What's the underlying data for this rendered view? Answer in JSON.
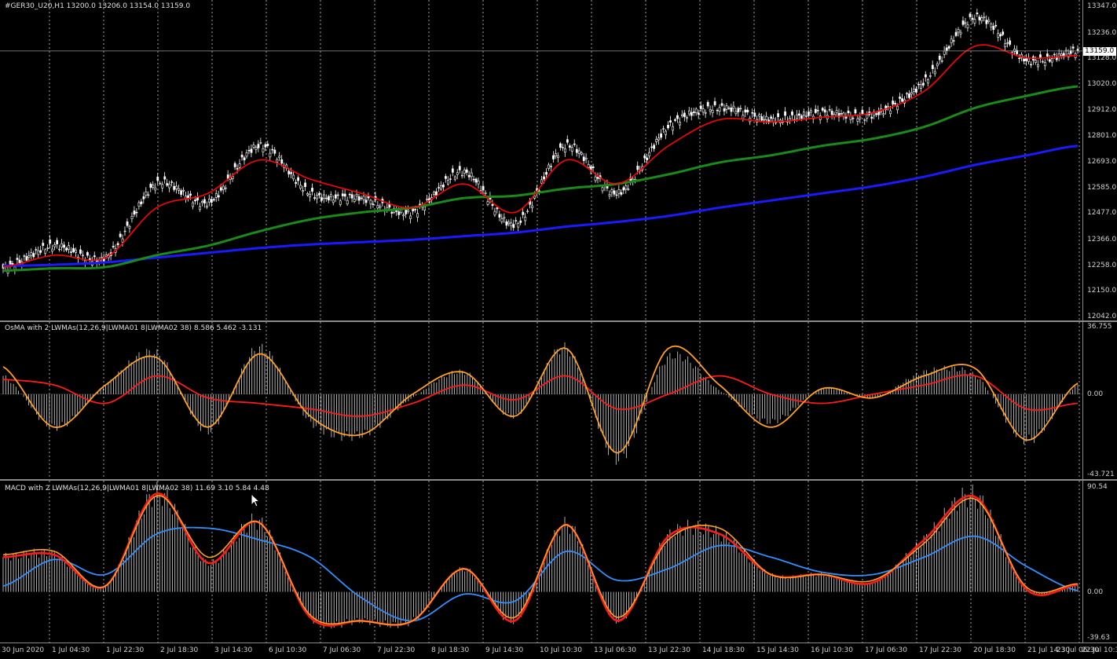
{
  "colors": {
    "background": "#000000",
    "grid": "#c0c0c0",
    "candles": "#ffffff",
    "ma_fast": "#ff0000",
    "ma_mid": "#1a8a1a",
    "ma_slow": "#1a1aff",
    "osma_line": "#ffa020",
    "osma_signal": "#ff1a1a",
    "macd_line": "#ff1a1a",
    "macd_signal_fast": "#ffa020",
    "macd_signal_slow": "#3090ff"
  },
  "main": {
    "caption": "#GER30_U20,H1  13200.0 13206.0 13154.0 13159.0",
    "current_price": "13159.0",
    "price_ticks": [
      "13347.0",
      "13236.0",
      "13128.0",
      "13020.0",
      "12912.0",
      "12801.0",
      "12693.0",
      "12585.0",
      "12477.0",
      "12366.0",
      "12258.0",
      "12150.0",
      "12042.0"
    ]
  },
  "osma": {
    "caption": "OsMA with 2 LWMAs(12,26,9|LWMA01 8|LWMA02 38) 8.586 5.462 -3.131",
    "ticks": [
      "36.755",
      "0.00",
      "-43.721"
    ]
  },
  "macd": {
    "caption": "MACD with 2 LWMAs(12,26,9|LWMA01 8|LWMA02 38) 11.69 3.10 5.84 4.48",
    "ticks": [
      "90.54",
      "0.00",
      "-39.63"
    ]
  },
  "time_axis": [
    "30 Jun 2020",
    "1 Jul 04:30",
    "1 Jul 22:30",
    "2 Jul 18:30",
    "3 Jul 14:30",
    "6 Jul 10:30",
    "7 Jul 06:30",
    "7 Jul 22:30",
    "8 Jul 18:30",
    "9 Jul 14:30",
    "10 Jul 10:30",
    "13 Jul 06:30",
    "13 Jul 22:30",
    "14 Jul 18:30",
    "15 Jul 14:30",
    "16 Jul 10:30",
    "17 Jul 06:30",
    "17 Jul 22:30",
    "20 Jul 18:30",
    "21 Jul 14:30",
    "22 Jul 10:30",
    "23 Jul 06:30"
  ],
  "chart_data": [
    {
      "type": "line",
      "title": "#GER30_U20,H1",
      "ohlc_last": {
        "open": 13200.0,
        "high": 13206.0,
        "low": 13154.0,
        "close": 13159.0
      },
      "ylim": [
        12042.0,
        13347.0
      ],
      "x": [
        "30 Jun 2020",
        "1 Jul 04:30",
        "1 Jul 22:30",
        "2 Jul 18:30",
        "3 Jul 14:30",
        "6 Jul 10:30",
        "7 Jul 06:30",
        "7 Jul 22:30",
        "8 Jul 18:30",
        "9 Jul 14:30",
        "10 Jul 10:30",
        "13 Jul 06:30",
        "13 Jul 22:30",
        "14 Jul 18:30",
        "15 Jul 14:30",
        "16 Jul 10:30",
        "17 Jul 06:30",
        "17 Jul 22:30",
        "20 Jul 18:30",
        "21 Jul 14:30",
        "22 Jul 10:30",
        "23 Jul 06:30"
      ],
      "series": [
        {
          "role": "price",
          "values": [
            12245,
            12340,
            12290,
            12600,
            12520,
            12760,
            12560,
            12540,
            12480,
            12650,
            12430,
            12760,
            12560,
            12840,
            12920,
            12870,
            12900,
            12890,
            13030,
            13300,
            13120,
            13160
          ]
        },
        {
          "role": "ma_fast",
          "values": [
            12250,
            12300,
            12290,
            12500,
            12560,
            12700,
            12620,
            12560,
            12500,
            12600,
            12480,
            12700,
            12600,
            12760,
            12870,
            12860,
            12880,
            12900,
            12990,
            13180,
            13130,
            13140
          ]
        },
        {
          "role": "ma_mid",
          "values": [
            12235,
            12245,
            12250,
            12300,
            12340,
            12400,
            12450,
            12480,
            12500,
            12540,
            12550,
            12580,
            12600,
            12640,
            12690,
            12720,
            12760,
            12790,
            12840,
            12920,
            12970,
            13010
          ]
        },
        {
          "role": "ma_slow",
          "values": [
            12255,
            12260,
            12270,
            12290,
            12310,
            12330,
            12345,
            12355,
            12365,
            12380,
            12395,
            12420,
            12440,
            12465,
            12500,
            12530,
            12560,
            12590,
            12630,
            12680,
            12720,
            12760
          ]
        }
      ]
    },
    {
      "type": "line",
      "title": "OsMA with 2 LWMAs(12,26,9|LWMA01 8|LWMA02 38)",
      "ylim": [
        -43.721,
        36.755
      ],
      "x": [
        "30 Jun 2020",
        "1 Jul 04:30",
        "1 Jul 22:30",
        "2 Jul 18:30",
        "3 Jul 14:30",
        "6 Jul 10:30",
        "7 Jul 06:30",
        "7 Jul 22:30",
        "8 Jul 18:30",
        "9 Jul 14:30",
        "10 Jul 10:30",
        "13 Jul 06:30",
        "13 Jul 22:30",
        "14 Jul 18:30",
        "15 Jul 14:30",
        "16 Jul 10:30",
        "17 Jul 06:30",
        "17 Jul 22:30",
        "20 Jul 18:30",
        "21 Jul 14:30",
        "22 Jul 10:30",
        "23 Jul 06:30"
      ],
      "series": [
        {
          "role": "histogram",
          "values": [
            10,
            -18,
            5,
            22,
            -20,
            25,
            -15,
            -22,
            -2,
            12,
            -12,
            25,
            -35,
            20,
            2,
            -15,
            3,
            -2,
            12,
            10,
            -25,
            5
          ]
        },
        {
          "role": "osma",
          "values": [
            15,
            -18,
            5,
            20,
            -18,
            22,
            -12,
            -22,
            0,
            12,
            -12,
            25,
            -32,
            25,
            5,
            -18,
            3,
            -2,
            10,
            14,
            -25,
            6
          ]
        },
        {
          "role": "signal",
          "values": [
            8,
            5,
            -5,
            10,
            -2,
            -5,
            -8,
            -12,
            -5,
            5,
            -3,
            10,
            -8,
            0,
            10,
            0,
            -5,
            0,
            5,
            10,
            -8,
            -5
          ]
        }
      ]
    },
    {
      "type": "line",
      "title": "MACD with 2 LWMAs(12,26,9|LWMA01 8|LWMA02 38)",
      "ylim": [
        -39.63,
        90.54
      ],
      "x": [
        "30 Jun 2020",
        "1 Jul 04:30",
        "1 Jul 22:30",
        "2 Jul 18:30",
        "3 Jul 14:30",
        "6 Jul 10:30",
        "7 Jul 06:30",
        "7 Jul 22:30",
        "8 Jul 18:30",
        "9 Jul 14:30",
        "10 Jul 10:30",
        "13 Jul 06:30",
        "13 Jul 22:30",
        "14 Jul 18:30",
        "15 Jul 14:30",
        "16 Jul 10:30",
        "17 Jul 06:30",
        "17 Jul 22:30",
        "20 Jul 18:30",
        "21 Jul 14:30",
        "22 Jul 10:30",
        "23 Jul 06:30"
      ],
      "series": [
        {
          "role": "histogram",
          "values": [
            30,
            32,
            5,
            85,
            25,
            60,
            -22,
            -25,
            -25,
            20,
            -25,
            58,
            -25,
            48,
            50,
            15,
            15,
            8,
            45,
            82,
            2,
            6
          ]
        },
        {
          "role": "macd",
          "values": [
            30,
            32,
            5,
            85,
            25,
            60,
            -22,
            -25,
            -25,
            20,
            -25,
            58,
            -25,
            48,
            50,
            15,
            15,
            8,
            45,
            82,
            2,
            6
          ]
        },
        {
          "role": "signal_fast",
          "values": [
            32,
            35,
            5,
            83,
            30,
            60,
            -20,
            -25,
            -25,
            20,
            -22,
            58,
            -22,
            45,
            55,
            15,
            15,
            10,
            42,
            80,
            4,
            7
          ]
        },
        {
          "role": "signal_slow",
          "values": [
            5,
            28,
            15,
            50,
            55,
            45,
            30,
            -5,
            -25,
            -2,
            -8,
            35,
            10,
            20,
            40,
            30,
            17,
            15,
            30,
            48,
            22,
            1
          ]
        }
      ]
    }
  ]
}
